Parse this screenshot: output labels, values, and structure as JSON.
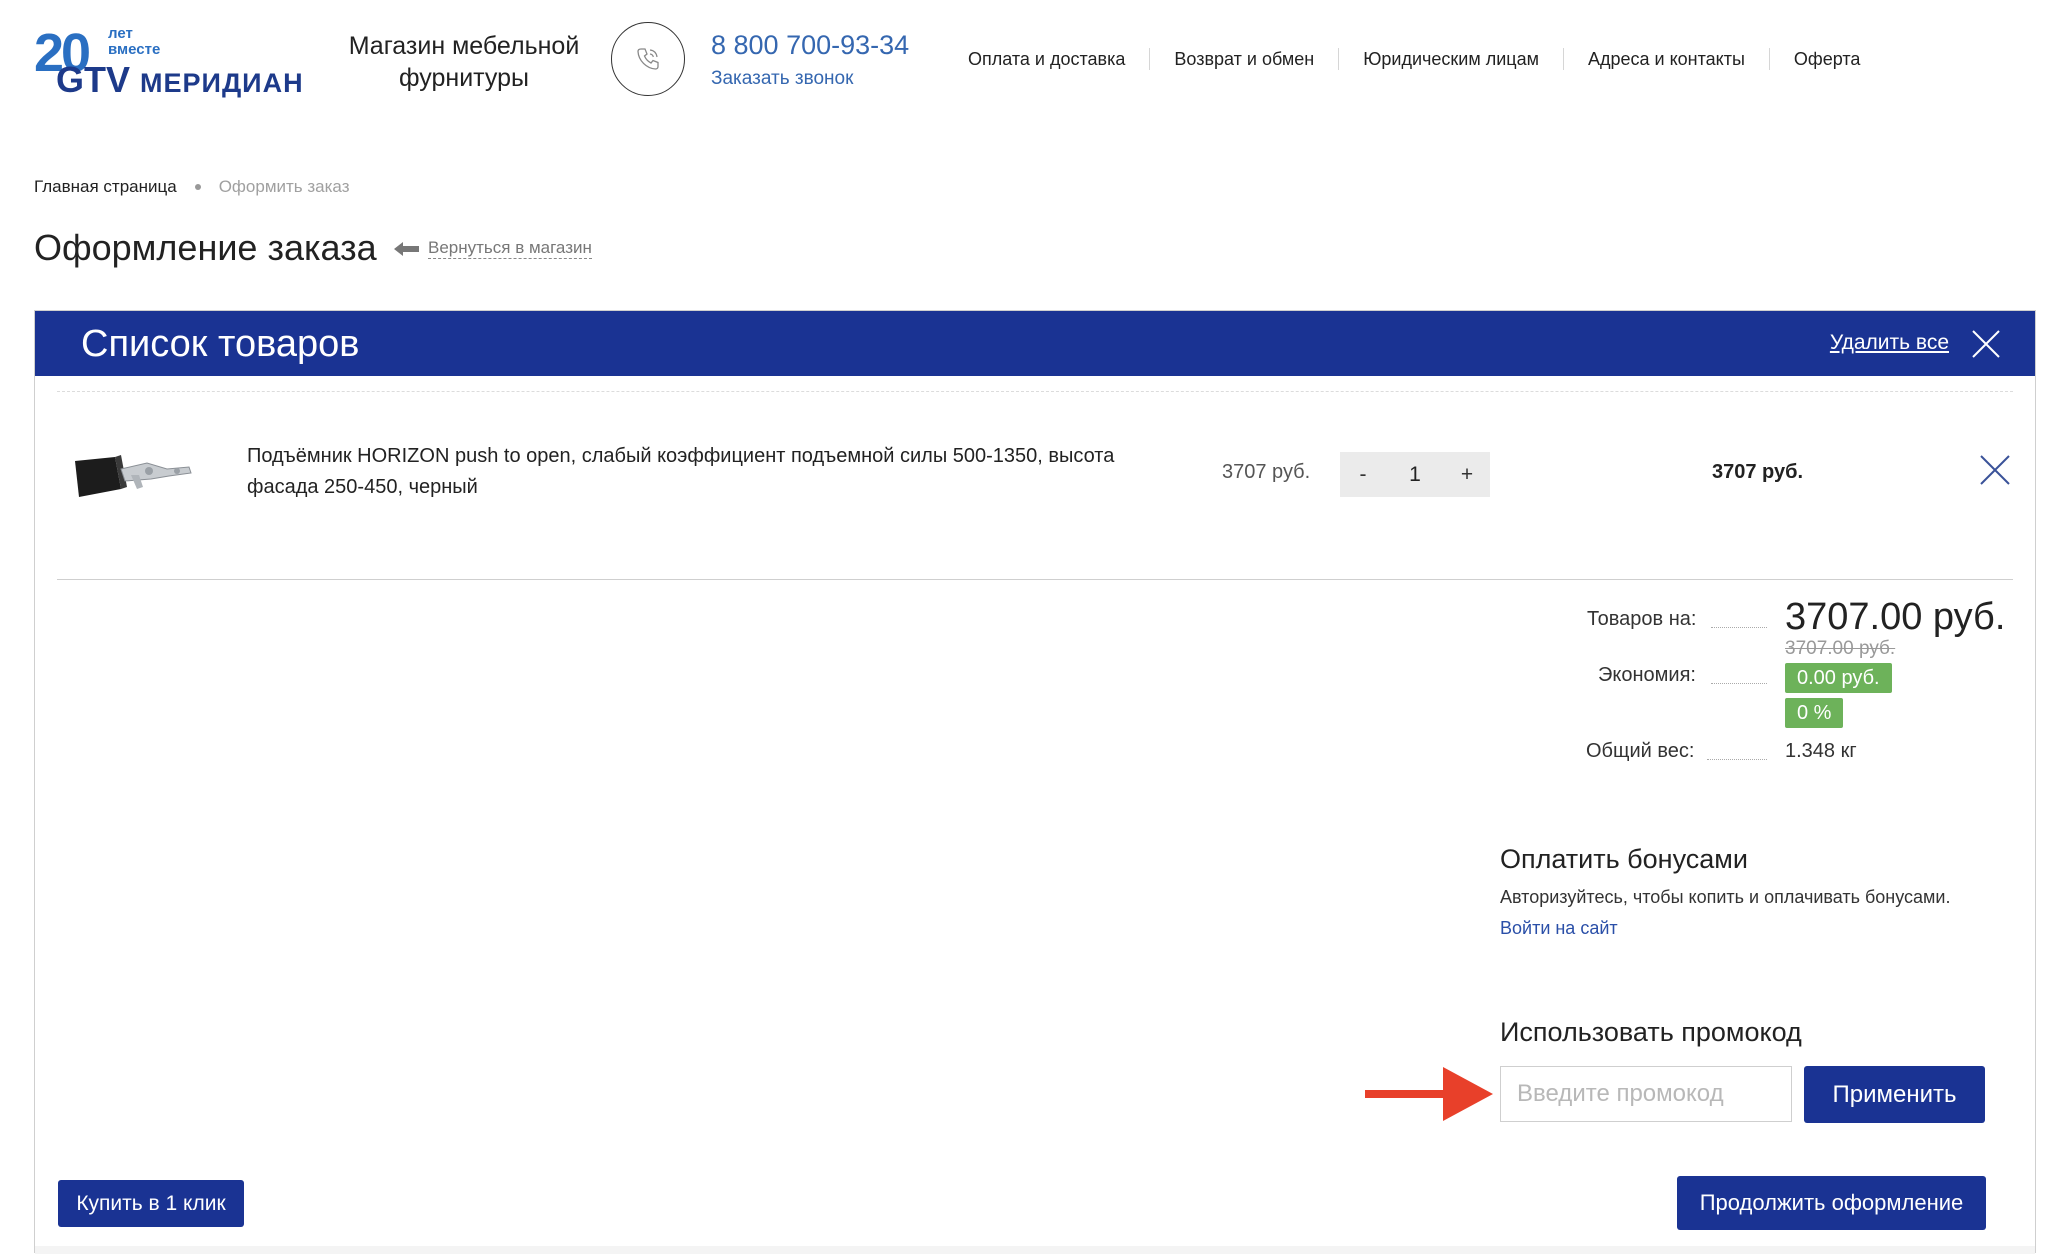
{
  "header": {
    "logo": {
      "years_number": "20",
      "years_text": "лет вместе",
      "brand_latin": "GTV",
      "brand_cyrillic": "МЕРИДИАН"
    },
    "shop_title": "Магазин мебельной фурнитуры",
    "phone": "8 800 700-93-34",
    "callback_link": "Заказать звонок",
    "phone_icon": "phone-icon",
    "nav": [
      "Оплата и доставка",
      "Возврат и обмен",
      "Юридическим лицам",
      "Адреса и контакты",
      "Оферта"
    ]
  },
  "breadcrumb": {
    "home": "Главная страница",
    "current": "Оформить заказ"
  },
  "page": {
    "title": "Оформление заказа",
    "back_link": "Вернуться в магазин"
  },
  "cart": {
    "title": "Список товаров",
    "delete_all": "Удалить все",
    "items": [
      {
        "name": "Подъёмник HORIZON push to open, слабый коэффициент подъемной силы 500-1350, высота фасада 250-450, черный",
        "unit_price": "3707 руб.",
        "qty_minus": "-",
        "quantity": "1",
        "qty_plus": "+",
        "total": "3707 руб."
      }
    ]
  },
  "totals": {
    "goods_label": "Товаров на:",
    "goods_amount": "3707.00 руб.",
    "goods_old_amount": "3707.00 руб.",
    "savings_label": "Экономия:",
    "savings_amount": "0.00 руб.",
    "savings_percent": "0 %",
    "weight_label": "Общий вес:",
    "weight_value": "1.348 кг"
  },
  "bonuses": {
    "title": "Оплатить бонусами",
    "text": "Авторизуйтесь, чтобы копить и оплачивать бонусами.",
    "login_link": "Войти на сайт"
  },
  "promo": {
    "title": "Использовать промокод",
    "placeholder": "Введите промокод",
    "apply_label": "Применить"
  },
  "actions": {
    "one_click": "Купить в 1 клик",
    "continue": "Продолжить оформление"
  },
  "colors": {
    "brand_blue": "#1a3393",
    "link_blue": "#3567b0",
    "badge_green": "#6db25a",
    "annotation_red": "#e8402a"
  }
}
